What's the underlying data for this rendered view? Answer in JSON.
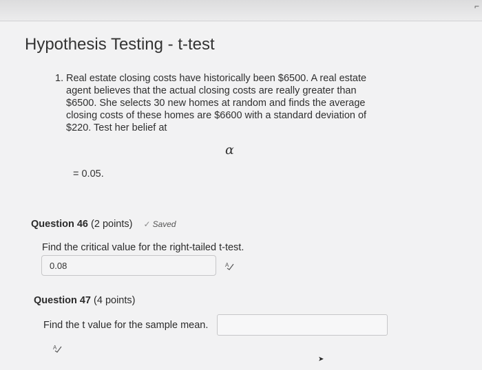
{
  "page": {
    "title": "Hypothesis Testing - t-test"
  },
  "problem": {
    "number": "1.",
    "lines": [
      "Real estate closing costs have historically been $6500.  A real estate",
      "agent believes that the actual closing costs are really greater than",
      "$6500.  She selects 30 new homes at random and finds the average",
      "closing costs of these homes are $6600 with a standard deviation of",
      "$220.  Test her belief at"
    ],
    "alpha_symbol": "α",
    "alpha_value": "= 0.05."
  },
  "question46": {
    "title": "Question 46",
    "points": "(2 points)",
    "saved_label": "Saved",
    "prompt": "Find the critical value for the right-tailed t-test.",
    "answer": "0.08"
  },
  "question47": {
    "title": "Question 47",
    "points": "(4 points)",
    "prompt": "Find the t value for the sample mean.",
    "answer": ""
  },
  "icons": {
    "saved": "check-icon",
    "spellcheck": "spellcheck-icon",
    "cursor": "cursor-icon"
  }
}
